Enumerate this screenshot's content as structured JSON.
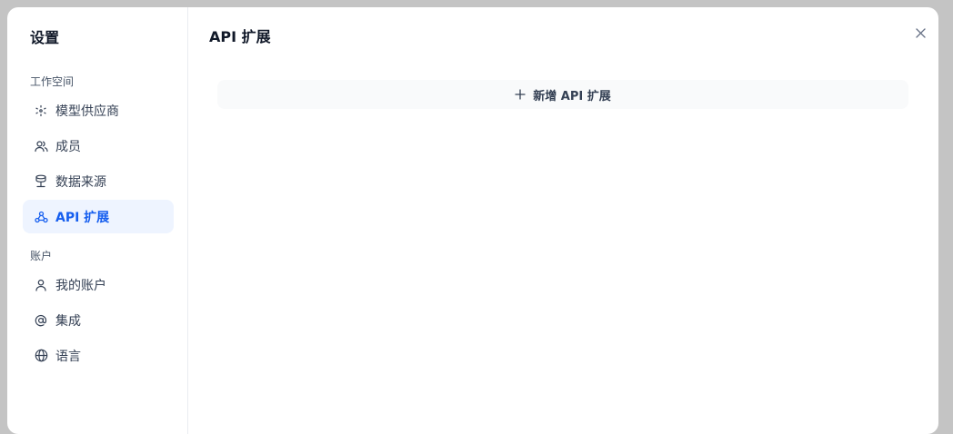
{
  "sidebar": {
    "title": "设置",
    "groups": [
      {
        "label": "工作空间"
      },
      {
        "label": "账户"
      }
    ],
    "items": [
      {
        "label": "模型供应商",
        "icon": "cube-outline-icon"
      },
      {
        "label": "成员",
        "icon": "users-icon"
      },
      {
        "label": "数据来源",
        "icon": "database-icon"
      },
      {
        "label": "API 扩展",
        "icon": "webhook-icon",
        "active": true
      },
      {
        "label": "我的账户",
        "icon": "user-icon"
      },
      {
        "label": "集成",
        "icon": "at-sign-icon"
      },
      {
        "label": "语言",
        "icon": "globe-icon"
      }
    ]
  },
  "main": {
    "title": "API 扩展",
    "add_button_label": "新增 API 扩展"
  },
  "colors": {
    "accent": "#155eef",
    "active_bg": "#eef4ff",
    "overlay": "#c4c4c4"
  }
}
